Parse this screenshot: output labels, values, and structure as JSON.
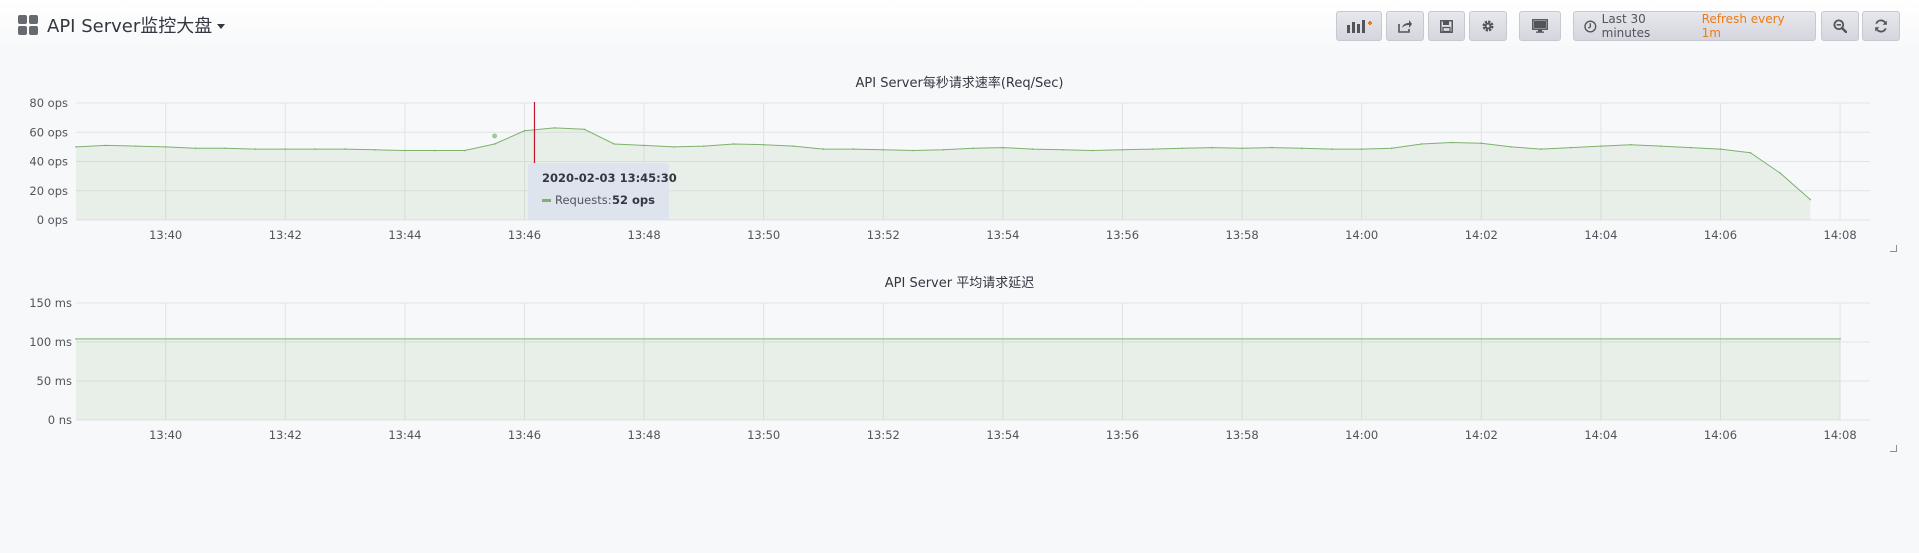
{
  "dashboard": {
    "title": "API Server监控大盘"
  },
  "toolbar": {
    "add_panel_icon": "add-panel-icon",
    "share_icon": "share-icon",
    "save_icon": "save-icon",
    "settings_icon": "gear-icon",
    "tv_mode_icon": "monitor-icon",
    "time_range": "Last 30 minutes",
    "refresh_text": "Refresh every 1m",
    "zoom_icon": "zoom-out-icon",
    "reload_icon": "refresh-icon"
  },
  "colors": {
    "series_line": "#7eb26d",
    "series_fill": "rgba(126,178,109,0.12)",
    "crosshair": "#c4162a",
    "refresh_text": "#eb7b18",
    "tooltip_bg": "#dde4ed"
  },
  "tooltip": {
    "time": "2020-02-03 13:45:30",
    "label": "Requests:",
    "value": "52 ops"
  },
  "chart_data": [
    {
      "type": "area",
      "title": "API Server每秒请求速率(Req/Sec)",
      "xlabel": "",
      "ylabel": "",
      "x_ticks": [
        "13:40",
        "13:42",
        "13:44",
        "13:46",
        "13:48",
        "13:50",
        "13:52",
        "13:54",
        "13:56",
        "13:58",
        "14:00",
        "14:02",
        "14:04",
        "14:06",
        "14:08"
      ],
      "y_ticks": [
        "0 ops",
        "20 ops",
        "40 ops",
        "60 ops",
        "80 ops"
      ],
      "ylim": [
        0,
        80
      ],
      "xlim": [
        "13:38:30",
        "14:08:30"
      ],
      "grid": true,
      "legend": "none",
      "series": [
        {
          "name": "Requests",
          "x": [
            "13:38:30",
            "13:39:00",
            "13:39:30",
            "13:40:00",
            "13:40:30",
            "13:41:00",
            "13:41:30",
            "13:42:00",
            "13:42:30",
            "13:43:00",
            "13:43:30",
            "13:44:00",
            "13:44:30",
            "13:45:00",
            "13:45:30",
            "13:46:00",
            "13:46:30",
            "13:47:00",
            "13:47:30",
            "13:48:00",
            "13:48:30",
            "13:49:00",
            "13:49:30",
            "13:50:00",
            "13:50:30",
            "13:51:00",
            "13:51:30",
            "13:52:00",
            "13:52:30",
            "13:53:00",
            "13:53:30",
            "13:54:00",
            "13:54:30",
            "13:55:00",
            "13:55:30",
            "13:56:00",
            "13:56:30",
            "13:57:00",
            "13:57:30",
            "13:58:00",
            "13:58:30",
            "13:59:00",
            "13:59:30",
            "14:00:00",
            "14:00:30",
            "14:01:00",
            "14:01:30",
            "14:02:00",
            "14:02:30",
            "14:03:00",
            "14:03:30",
            "14:04:00",
            "14:04:30",
            "14:05:00",
            "14:05:30",
            "14:06:00",
            "14:06:30",
            "14:07:00",
            "14:07:30"
          ],
          "values": [
            50,
            51,
            50.5,
            50,
            49,
            49,
            48.5,
            48.5,
            48.5,
            48.5,
            48,
            47.5,
            47.5,
            47.5,
            52,
            61,
            63,
            62,
            52,
            51,
            50,
            50.5,
            52,
            51.5,
            50.5,
            48.5,
            48.5,
            48,
            47.5,
            48,
            49,
            49.5,
            48.5,
            48,
            47.5,
            48,
            48.5,
            49,
            49.5,
            49,
            49.5,
            49,
            48.5,
            48.5,
            49,
            52,
            53,
            52.5,
            50,
            48.5,
            49.5,
            50.5,
            51.5,
            50.5,
            49.5,
            48.5,
            46,
            32,
            14
          ]
        }
      ]
    },
    {
      "type": "area",
      "title": "API Server 平均请求延迟",
      "xlabel": "",
      "ylabel": "",
      "x_ticks": [
        "13:40",
        "13:42",
        "13:44",
        "13:46",
        "13:48",
        "13:50",
        "13:52",
        "13:54",
        "13:56",
        "13:58",
        "14:00",
        "14:02",
        "14:04",
        "14:06",
        "14:08"
      ],
      "y_ticks": [
        "0 ns",
        "50 ms",
        "100 ms",
        "150 ms"
      ],
      "ylim": [
        0,
        150
      ],
      "xlim": [
        "13:38:30",
        "14:08:30"
      ],
      "grid": true,
      "legend": "none",
      "series": [
        {
          "name": "Latency",
          "x": [
            "13:38:30",
            "14:08:00"
          ],
          "values": [
            104,
            104
          ]
        }
      ]
    }
  ]
}
